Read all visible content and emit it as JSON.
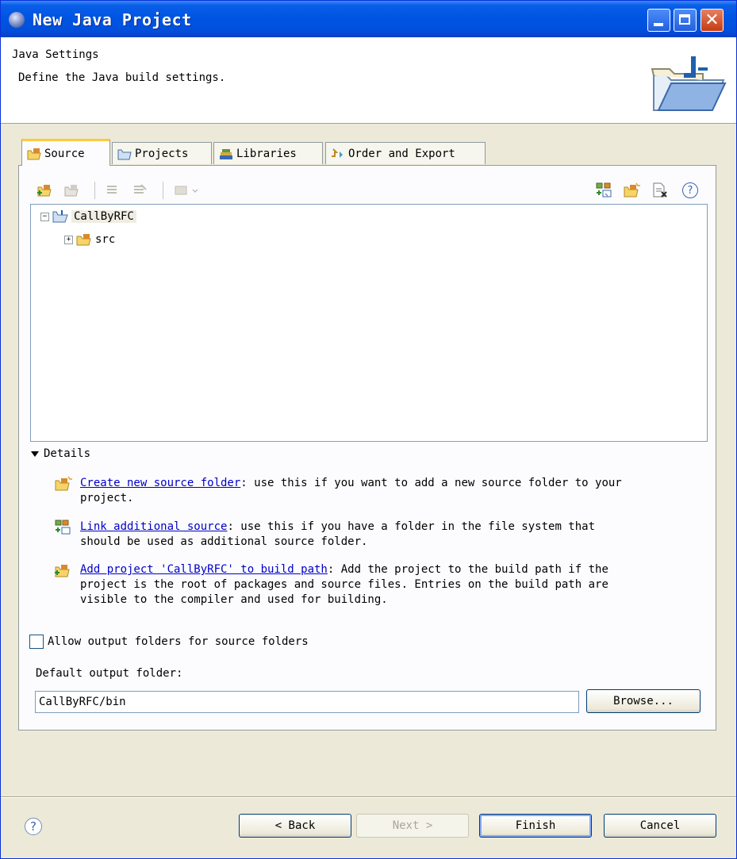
{
  "window": {
    "title": "New Java Project",
    "controls": [
      "minimize",
      "maximize",
      "close"
    ]
  },
  "header": {
    "title": "Java Settings",
    "description": "Define the Java build settings."
  },
  "tabs": [
    {
      "label": "Source",
      "icon": "source-folder-icon",
      "active": true
    },
    {
      "label": "Projects",
      "icon": "projects-icon",
      "active": false
    },
    {
      "label": "Libraries",
      "icon": "libraries-icon",
      "active": false
    },
    {
      "label": "Order and Export",
      "icon": "order-export-icon",
      "active": false
    }
  ],
  "toolbar": {
    "left_icons": [
      "add-source-folder-icon",
      "remove-icon",
      "include-icon",
      "exclude-icon",
      "configure-icon"
    ],
    "right_icons": [
      "link-source-icon",
      "create-folder-icon",
      "remove-file-icon",
      "help-icon"
    ],
    "help_glyph": "?"
  },
  "tree": {
    "root": {
      "label": "CallByRFC",
      "expander": "−"
    },
    "child": {
      "label": "src",
      "expander": "+"
    }
  },
  "details": {
    "heading": "Details",
    "items": [
      {
        "link": "Create new source folder",
        "rest": ": use this if you want to add a new source folder to your",
        "line2": "project."
      },
      {
        "link": "Link additional source",
        "rest": ": use this if you have a folder in the file system that",
        "line2": "should be used as additional source folder."
      },
      {
        "link": "Add project 'CallByRFC' to build path",
        "rest": ": Add the project to the build path if the",
        "line2": "project is the root of packages and source files. Entries on the build path are",
        "line3": "visible to the compiler and used for building."
      }
    ]
  },
  "output": {
    "allow_label": "Allow output folders for source folders",
    "allow_checked": false,
    "default_label": "Default output folder:",
    "default_value": "CallByRFC/bin",
    "browse_label": "Browse..."
  },
  "buttons": {
    "help": "?",
    "back": "< Back",
    "next": "Next >",
    "finish": "Finish",
    "cancel": "Cancel"
  },
  "colors": {
    "titlebar": "#0054e3",
    "link": "#0000c8",
    "dialog_bg": "#ece9d8",
    "active_tab_highlight": "#ffc83c"
  }
}
